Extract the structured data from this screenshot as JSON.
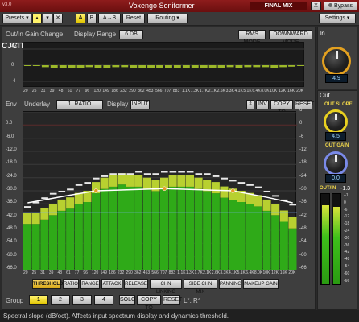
{
  "app": {
    "version": "v3.0",
    "title": "Voxengo Soniformer",
    "preset_name": "FINAL MIX",
    "x_label": "X",
    "bypass_label": "Bypass",
    "settings_label": "Settings",
    "presets_label": "Presets"
  },
  "topbar": {
    "compare_a": "A",
    "compare_b": "B",
    "a_to_b": "A→B",
    "reset": "Reset",
    "routing": "Routing"
  },
  "watermark": "CJCITY.RU",
  "gain_change": {
    "title": "Out/In Gain Change",
    "display_range_label": "Display Range",
    "display_range_value": "6 DB",
    "rms_mode": "RMS MODE",
    "downward_mode": "DOWNWARD MODE",
    "y_ticks": [
      "+4",
      "0",
      "-4"
    ]
  },
  "freq_ticks": [
    "20",
    "25",
    "31",
    "39",
    "48",
    "61",
    "77",
    "96",
    "120",
    "149",
    "186",
    "232",
    "290",
    "362",
    "453",
    "566",
    "707",
    "883",
    "1.1K",
    "1.3K",
    "1.7K",
    "2.1K",
    "2.6K",
    "3.3K",
    "4.1K",
    "5.1K",
    "6.4K",
    "8.0K",
    "10K",
    "12K",
    "16K",
    "20K"
  ],
  "env": {
    "title": "Env",
    "underlay_label": "Underlay",
    "underlay_value": "1: RATIO",
    "display_label": "Display",
    "display_value": "INPUT",
    "inv": "INV",
    "copy_to": "COPY TO",
    "reset": "RESET",
    "left_ticks": [
      "0.0",
      "-6.0",
      "-12.0",
      "-18.0",
      "-24.0",
      "-30.0",
      "-36.0",
      "-42.0",
      "-48.0",
      "-54.0",
      "-60.0",
      "-66.0"
    ],
    "right_ticks": [
      "6",
      "0",
      "-6",
      "-12",
      "-18",
      "-24",
      "-30",
      "-36",
      "-42",
      "-48",
      "-54",
      "-60",
      "-66"
    ]
  },
  "mode_buttons": [
    "THRESHOLD",
    "RATIO",
    "RANGE",
    "ATTACK",
    "RELEASE",
    "CHN LINKING",
    "SIDE CHN MIX",
    "PANNING",
    "MAKEUP GAIN"
  ],
  "group": {
    "label": "Group",
    "items": [
      "1",
      "2",
      "3",
      "4"
    ],
    "solo": "SOLO",
    "copy_to": "COPY TO",
    "reset": "RESET",
    "channels": "L*, R*"
  },
  "in_section": {
    "title": "In",
    "value": "4.9"
  },
  "out_section": {
    "title": "Out",
    "slope_label": "OUT SLOPE",
    "slope_value": "4.5",
    "gain_label": "OUT GAIN",
    "gain_value": "0.0",
    "outin_label": "OUT/IN",
    "outin_value": "-1.3",
    "meter_ticks": [
      "+1",
      "0",
      "-6",
      "-12",
      "-18",
      "-24",
      "-30",
      "-36",
      "-42",
      "-48",
      "-54",
      "-60",
      "-66"
    ]
  },
  "status": "Spectral slope (dB/oct). Affects input spectrum display and dynamics threshold.",
  "colors": {
    "title_red": "#7a1414",
    "spectrum_green": "#33c01a",
    "spectrum_yellow": "#d8e23a",
    "highlight_yellow": "#fff26a",
    "threshold_orange": "#e89a2a"
  },
  "chart_data": {
    "type": "bar",
    "title": "",
    "input_spectrum_db": [
      -40,
      -40,
      -38,
      -36,
      -34,
      -33,
      -31,
      -30,
      -26,
      -24,
      -23,
      -22,
      -23,
      -23,
      -24,
      -25,
      -24,
      -23,
      -23,
      -23,
      -24,
      -25,
      -26,
      -28,
      -29,
      -30,
      -31,
      -32,
      -34,
      -36,
      -39,
      -42
    ],
    "peak_marks_db": [
      -37,
      -35,
      -33,
      -31,
      -30,
      -29,
      -27,
      -26,
      -24,
      -23,
      -22,
      -22,
      -22,
      -21,
      -22,
      -22,
      -21,
      -21,
      -21,
      -21,
      -22,
      -22,
      -23,
      -24,
      -25,
      -26,
      -27,
      -28,
      -30,
      -32,
      -34,
      -36
    ],
    "threshold_curve_db": [
      [
        0,
        -35.5
      ],
      [
        5,
        -32
      ],
      [
        8,
        -30
      ],
      [
        12,
        -29.5
      ],
      [
        16,
        -29
      ],
      [
        20,
        -29.5
      ],
      [
        24,
        -30
      ],
      [
        28,
        -33
      ],
      [
        31,
        -35.5
      ]
    ],
    "threshold_nodes": [
      8,
      16,
      24
    ],
    "gain_change_db": [
      0,
      0,
      -0.4,
      -0.6,
      -0.6,
      -0.5,
      -0.5,
      -0.4,
      -0.5,
      -0.5,
      -0.4,
      -0.4,
      -0.5,
      -0.5,
      -0.6,
      -0.5,
      -0.5,
      -0.6,
      -0.6,
      -0.5,
      -0.5,
      -0.6,
      -0.5,
      -0.4,
      -0.5,
      -0.4,
      -0.4,
      -0.4,
      -0.5,
      -0.4,
      -0.3,
      0
    ],
    "ylim": [
      -66,
      6
    ]
  }
}
